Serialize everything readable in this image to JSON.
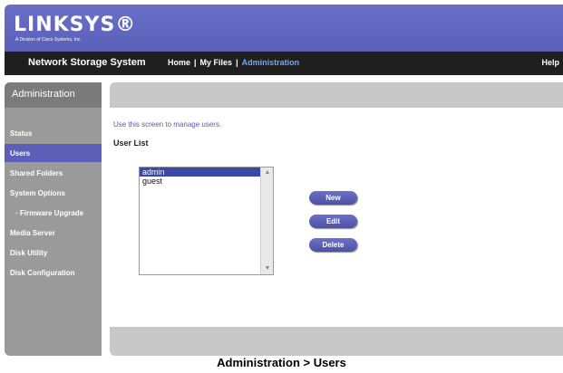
{
  "header": {
    "logo": "LINKSYS®",
    "logo_sub": "A Division of Cisco Systems, Inc."
  },
  "nav": {
    "title": "Network Storage System",
    "links": [
      "Home",
      "My Files",
      "Administration"
    ],
    "active_link": "Administration",
    "help": "Help"
  },
  "sidebar": {
    "header": "Administration",
    "items": [
      {
        "label": "Status"
      },
      {
        "label": "Users",
        "active": true
      },
      {
        "label": "Shared Folders"
      },
      {
        "label": "System Options"
      },
      {
        "label": "· Firmware Upgrade"
      },
      {
        "label": "Media Server"
      },
      {
        "label": "Disk Utility"
      },
      {
        "label": "Disk Configuration"
      }
    ]
  },
  "main": {
    "intro": "Use this screen to manage users.",
    "list_heading": "User List",
    "users": [
      "admin",
      "guest"
    ],
    "selected_user": "admin",
    "buttons": {
      "new": "New",
      "edit": "Edit",
      "delete": "Delete"
    }
  },
  "caption": "Administration > Users",
  "colors": {
    "brand": "#5a5fb8",
    "nav_bg": "#1f1f1f",
    "selection": "#3b48a8"
  }
}
